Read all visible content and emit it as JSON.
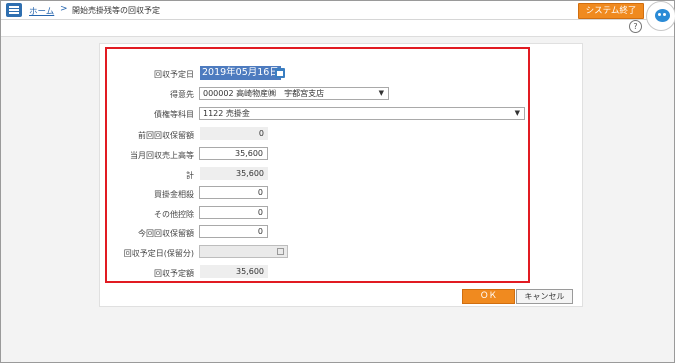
{
  "header": {
    "home_link": "ホーム",
    "separator": ">",
    "page_title": "開始売掛残等の回収予定",
    "exit_label": "システム終了",
    "help_glyph": "?"
  },
  "form": {
    "collection_date": {
      "label": "回収予定日",
      "value": "2019年05月16日"
    },
    "customer": {
      "label": "得意先",
      "value": "000002 高崎物産㈱　宇都宮支店"
    },
    "account": {
      "label": "債権等科目",
      "value": "1122 売掛金"
    },
    "prev_retained": {
      "label": "前回回収保留額",
      "value": "0"
    },
    "current_sales": {
      "label": "当月回収売上高等",
      "value": "35,600"
    },
    "total": {
      "label": "計",
      "value": "35,600"
    },
    "payable_offset": {
      "label": "買掛金相殺",
      "value": "0"
    },
    "other_deduction": {
      "label": "その他控除",
      "value": "0"
    },
    "current_retained": {
      "label": "今回回収保留額",
      "value": "0"
    },
    "retained_date": {
      "label": "回収予定日(保留分)",
      "value": ""
    },
    "collection_amount": {
      "label": "回収予定額",
      "value": "35,600"
    }
  },
  "buttons": {
    "ok": "ＯＫ",
    "cancel": "キャンセル"
  },
  "colors": {
    "accent": "#f08a1f",
    "highlight_border": "#e11b22",
    "link": "#2565ae",
    "selection": "#4d7bbf"
  },
  "icons": [
    "menu-icon",
    "help-icon",
    "calendar-icon",
    "mascot-icon",
    "chevron-down-icon"
  ]
}
